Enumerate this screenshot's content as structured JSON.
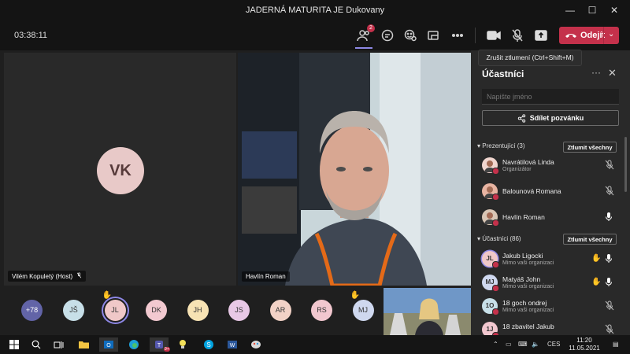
{
  "window": {
    "title": "JADERNÁ MATURITA JE Dukovany",
    "minimize": "—",
    "maximize": "☐",
    "close": "✕"
  },
  "callbar": {
    "timer": "03:38:11",
    "participants_badge": "2",
    "leave_label": "Odejít",
    "icons": [
      "people-icon",
      "chat-icon",
      "reactions-icon",
      "rooms-icon",
      "more-icon",
      "camera-icon",
      "mic-off-icon",
      "share-icon",
      "phone-icon"
    ]
  },
  "tooltip": "Zrušit ztlumení (Ctrl+Shift+M)",
  "stage": {
    "left_tile": {
      "initials": "VK",
      "name": "Vilém Kopuletý (Host)"
    },
    "right_tile": {
      "name": "Havlín Roman"
    }
  },
  "panel": {
    "title": "Účastníci",
    "search_placeholder": "Napište jméno",
    "share_label": "Sdílet pozvánku",
    "presenters": {
      "label": "Prezentující (3)",
      "mute_all": "Ztlumit všechny",
      "people": [
        {
          "name": "Navrátilová Linda",
          "sub": "Organizátor",
          "mic": "off"
        },
        {
          "name": "Balounová Romana",
          "sub": "",
          "mic": "off"
        },
        {
          "name": "Havlín Roman",
          "sub": "",
          "mic": "on"
        }
      ]
    },
    "attendees": {
      "label": "Účastníci (86)",
      "mute_all": "Ztlumit všechny",
      "people": [
        {
          "initials": "JL",
          "name": "Jakub Ligocki",
          "sub": "Mimo vaši organizaci",
          "hand": true,
          "mic": "on"
        },
        {
          "initials": "MJ",
          "name": "Matyáš John",
          "sub": "Mimo vaši organizaci",
          "hand": true,
          "mic": "on"
        },
        {
          "initials": "1O",
          "name": "18 goch ondrej",
          "sub": "Mimo vaši organizaci",
          "hand": false,
          "mic": "off"
        },
        {
          "initials": "1J",
          "name": "18 zbavitel Jakub",
          "sub": "",
          "hand": false,
          "mic": "off"
        }
      ]
    }
  },
  "strip": {
    "more": "+78",
    "avatars": [
      {
        "initials": "JŠ",
        "color": "#c7dfe8",
        "hand": false,
        "selected": false
      },
      {
        "initials": "JL",
        "color": "#f0c8c8",
        "hand": true,
        "selected": true
      },
      {
        "initials": "DK",
        "color": "#f2c9d0",
        "hand": false,
        "selected": false
      },
      {
        "initials": "JH",
        "color": "#f7e3b4",
        "hand": false,
        "selected": false
      },
      {
        "initials": "JS",
        "color": "#e8c8e6",
        "hand": false,
        "selected": false
      },
      {
        "initials": "AR",
        "color": "#f2d2c6",
        "hand": false,
        "selected": false
      },
      {
        "initials": "RS",
        "color": "#f2c7cf",
        "hand": false,
        "selected": false
      },
      {
        "initials": "MJ",
        "color": "#cfd8ef",
        "hand": true,
        "selected": false
      }
    ],
    "hand_glyph": "✋"
  },
  "taskbar": {
    "teams_badge": "9+",
    "tray_lang": "CES",
    "time": "11:20",
    "date": "11.05.2021"
  },
  "colors": {
    "accent": "#8e88e6",
    "danger": "#c4314b",
    "hand": "#f1c40f"
  }
}
